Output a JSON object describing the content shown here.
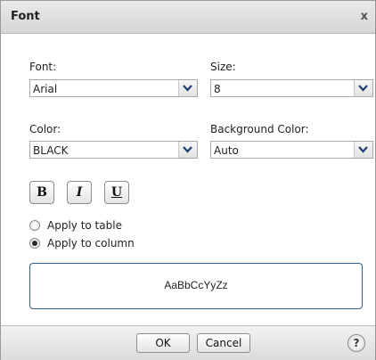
{
  "dialog": {
    "title": "Font",
    "close_label": "x"
  },
  "font": {
    "label": "Font:",
    "value": "Arial"
  },
  "size": {
    "label": "Size:",
    "value": "8"
  },
  "color": {
    "label": "Color:",
    "value": "BLACK"
  },
  "background_color": {
    "label": "Background Color:",
    "value": "Auto"
  },
  "format_buttons": {
    "bold": "B",
    "italic": "I",
    "underline": "U"
  },
  "apply_options": [
    {
      "label": "Apply to table",
      "selected": false
    },
    {
      "label": "Apply to column",
      "selected": true
    }
  ],
  "preview": {
    "text": "AaBbCcYyZz"
  },
  "footer": {
    "ok_label": "OK",
    "cancel_label": "Cancel",
    "help_label": "?"
  },
  "icons": {
    "dropdown": "chevron-down-icon",
    "help": "help-icon",
    "close": "close-icon"
  },
  "colors": {
    "preview_border": "#2f5f95",
    "titlebar": "#dcdcdc"
  }
}
